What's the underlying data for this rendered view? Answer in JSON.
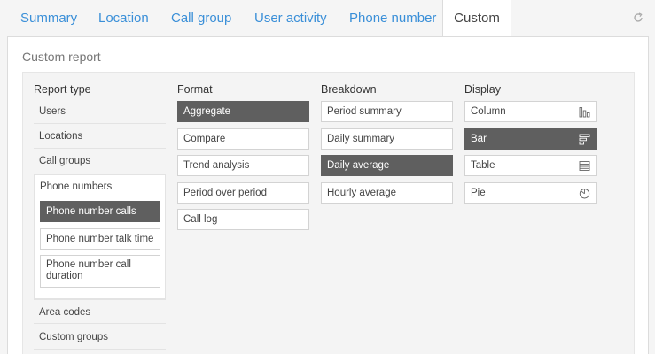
{
  "tabs": [
    {
      "label": "Summary",
      "active": false
    },
    {
      "label": "Location",
      "active": false
    },
    {
      "label": "Call group",
      "active": false
    },
    {
      "label": "User activity",
      "active": false
    },
    {
      "label": "Phone number",
      "active": false
    },
    {
      "label": "Custom",
      "active": true
    }
  ],
  "panel": {
    "title": "Custom report"
  },
  "report_type": {
    "title": "Report type",
    "items": [
      "Users",
      "Locations",
      "Call groups"
    ],
    "group": {
      "label": "Phone numbers",
      "options": [
        {
          "label": "Phone number calls",
          "selected": true
        },
        {
          "label": "Phone number talk time",
          "selected": false
        },
        {
          "label": "Phone number call duration",
          "selected": false
        }
      ]
    },
    "after_items": [
      "Area codes",
      "Custom groups"
    ]
  },
  "format": {
    "title": "Format",
    "options": [
      {
        "label": "Aggregate",
        "selected": true
      },
      {
        "label": "Compare",
        "selected": false
      },
      {
        "label": "Trend analysis",
        "selected": false
      },
      {
        "label": "Period over period",
        "selected": false
      },
      {
        "label": "Call log",
        "selected": false
      }
    ]
  },
  "breakdown": {
    "title": "Breakdown",
    "options": [
      {
        "label": "Period summary",
        "selected": false
      },
      {
        "label": "Daily summary",
        "selected": false
      },
      {
        "label": "Daily average",
        "selected": true
      },
      {
        "label": "Hourly average",
        "selected": false
      }
    ]
  },
  "display": {
    "title": "Display",
    "options": [
      {
        "label": "Column",
        "icon": "column-chart-icon",
        "selected": false
      },
      {
        "label": "Bar",
        "icon": "bar-chart-icon",
        "selected": true
      },
      {
        "label": "Table",
        "icon": "table-icon",
        "selected": false
      },
      {
        "label": "Pie",
        "icon": "pie-chart-icon",
        "selected": false
      }
    ]
  },
  "colors": {
    "link": "#3a8fd8",
    "selected_bg": "#5f5f5f"
  }
}
